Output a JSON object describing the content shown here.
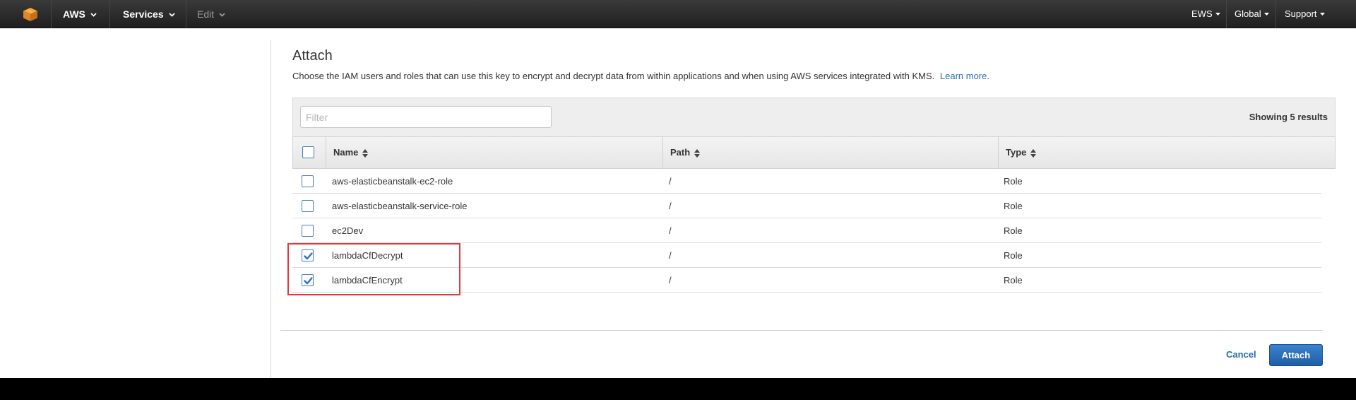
{
  "nav": {
    "brand": "AWS",
    "services": "Services",
    "edit": "Edit",
    "region_account": "EWS",
    "region": "Global",
    "support": "Support"
  },
  "page": {
    "title": "Attach",
    "description": "Choose the IAM users and roles that can use this key to encrypt and decrypt data from within applications and when using AWS services integrated with KMS.",
    "learn_more": "Learn more",
    "period": "."
  },
  "table": {
    "filter_placeholder": "Filter",
    "showing": "Showing 5 results",
    "columns": [
      "Name",
      "Path",
      "Type"
    ],
    "rows": [
      {
        "name": "aws-elasticbeanstalk-ec2-role",
        "path": "/",
        "type": "Role",
        "checked": false
      },
      {
        "name": "aws-elasticbeanstalk-service-role",
        "path": "/",
        "type": "Role",
        "checked": false
      },
      {
        "name": "ec2Dev",
        "path": "/",
        "type": "Role",
        "checked": false
      },
      {
        "name": "lambdaCfDecrypt",
        "path": "/",
        "type": "Role",
        "checked": true
      },
      {
        "name": "lambdaCfEncrypt",
        "path": "/",
        "type": "Role",
        "checked": true
      }
    ]
  },
  "actions": {
    "cancel": "Cancel",
    "attach": "Attach"
  },
  "colors": {
    "accent": "#2b6cb0",
    "highlight": "#e0393e",
    "nav_bg": "#232323"
  }
}
